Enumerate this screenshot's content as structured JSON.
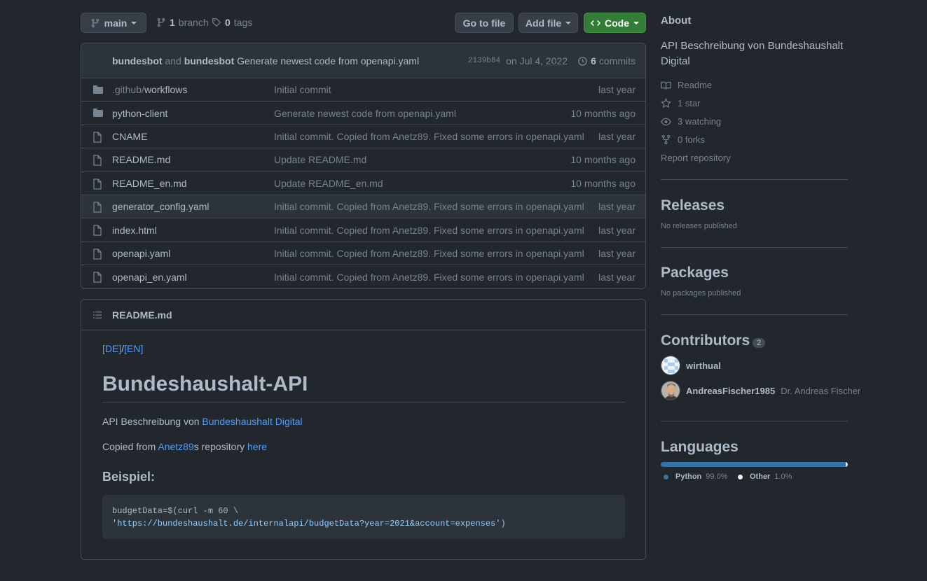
{
  "toolbar": {
    "branch": "main",
    "branch_count": "1",
    "branch_label": "branch",
    "tag_count": "0",
    "tag_label": "tags",
    "go_to_file": "Go to file",
    "add_file": "Add file",
    "code": "Code"
  },
  "commit": {
    "author1": "bundesbot",
    "and": "and",
    "author2": "bundesbot",
    "message": "Generate newest code from openapi.yaml",
    "sha": "2139b84",
    "date": "on Jul 4, 2022",
    "count": "6",
    "count_label": "commits"
  },
  "files": [
    {
      "type": "dir",
      "name_prefix": ".github/",
      "name": "workflows",
      "message": "Initial commit",
      "age": "last year"
    },
    {
      "type": "dir",
      "name_prefix": "",
      "name": "python-client",
      "message": "Generate newest code from openapi.yaml",
      "age": "10 months ago"
    },
    {
      "type": "file",
      "name_prefix": "",
      "name": "CNAME",
      "message": "Initial commit. Copied from Anetz89. Fixed some errors in openapi.yaml",
      "age": "last year"
    },
    {
      "type": "file",
      "name_prefix": "",
      "name": "README.md",
      "message": "Update README.md",
      "age": "10 months ago"
    },
    {
      "type": "file",
      "name_prefix": "",
      "name": "README_en.md",
      "message": "Update README_en.md",
      "age": "10 months ago"
    },
    {
      "type": "file",
      "name_prefix": "",
      "name": "generator_config.yaml",
      "message": "Initial commit. Copied from Anetz89. Fixed some errors in openapi.yaml",
      "age": "last year"
    },
    {
      "type": "file",
      "name_prefix": "",
      "name": "index.html",
      "message": "Initial commit. Copied from Anetz89. Fixed some errors in openapi.yaml",
      "age": "last year"
    },
    {
      "type": "file",
      "name_prefix": "",
      "name": "openapi.yaml",
      "message": "Initial commit. Copied from Anetz89. Fixed some errors in openapi.yaml",
      "age": "last year"
    },
    {
      "type": "file",
      "name_prefix": "",
      "name": "openapi_en.yaml",
      "message": "Initial commit. Copied from Anetz89. Fixed some errors in openapi.yaml",
      "age": "last year"
    }
  ],
  "readme": {
    "header": "README.md",
    "lang_de": "[DE]",
    "lang_sep": "/",
    "lang_en": "[EN]",
    "title": "Bundeshaushalt-API",
    "desc_prefix": "API Beschreibung von ",
    "desc_link": "Bundeshaushalt Digital",
    "copied_prefix": "Copied from ",
    "copied_link": "Anetz89",
    "copied_mid": "s repository ",
    "copied_here": "here",
    "example_heading": "Beispiel:",
    "code_line1_a": "budgetData=$(curl -m 60 \\",
    "code_line2": "'https://bundeshaushalt.de/internalapi/budgetData?year=2021&account=expenses'",
    "code_line2_end": ")"
  },
  "sidebar": {
    "about_title": "About",
    "about_desc": "API Beschreibung von Bundeshaushalt Digital",
    "readme": "Readme",
    "stars": "1 star",
    "watching": "3 watching",
    "forks": "0 forks",
    "report": "Report repository",
    "releases_title": "Releases",
    "releases_text": "No releases published",
    "packages_title": "Packages",
    "packages_text": "No packages published",
    "contributors_title": "Contributors",
    "contributors_count": "2",
    "contributors": [
      {
        "login": "wirthual",
        "name": ""
      },
      {
        "login": "AndreasFischer1985",
        "name": "Dr. Andreas Fischer"
      }
    ],
    "languages_title": "Languages",
    "languages": [
      {
        "name": "Python",
        "percent": "99.0%",
        "value": 99.0,
        "color": "#3572A5"
      },
      {
        "name": "Other",
        "percent": "1.0%",
        "value": 1.0,
        "color": "#ededed"
      }
    ]
  }
}
